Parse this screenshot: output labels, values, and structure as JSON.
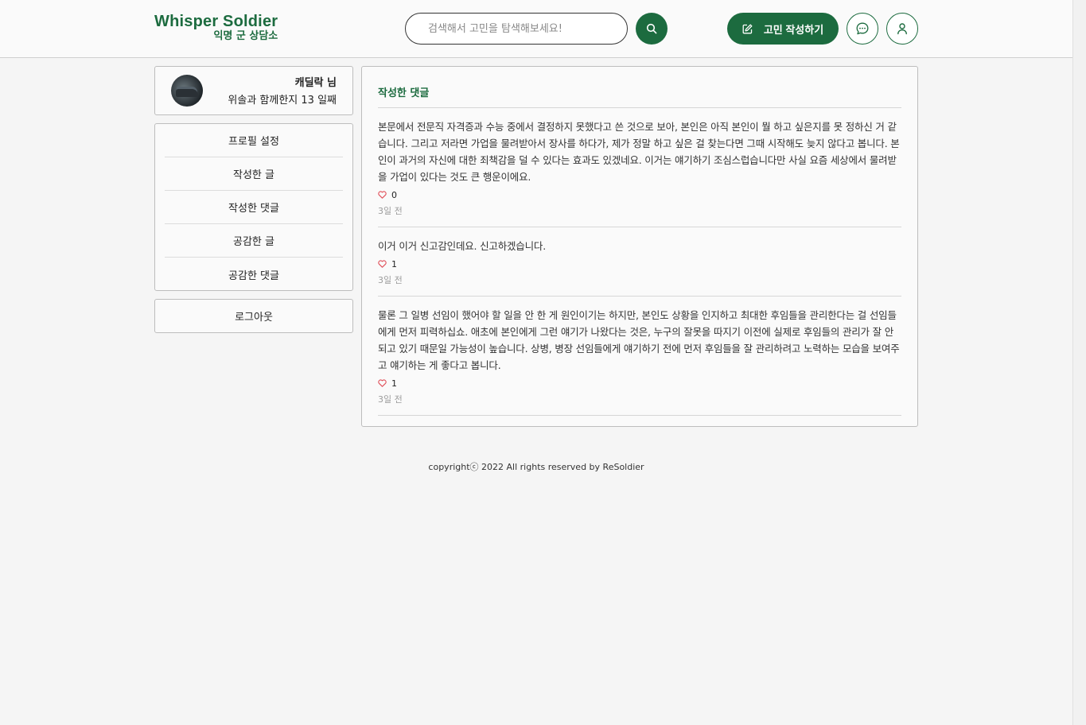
{
  "header": {
    "logo_title": "Whisper Soldier",
    "logo_subtitle": "익명 군 상담소",
    "search_placeholder": "검색해서 고민을 탐색해보세요!",
    "write_button": "고민 작성하기"
  },
  "profile": {
    "name": "캐딜락 님",
    "days_text": "위솔과 함께한지 13 일째"
  },
  "menu": {
    "items": [
      {
        "label": "프로필 설정"
      },
      {
        "label": "작성한 글"
      },
      {
        "label": "작성한 댓글"
      },
      {
        "label": "공감한 글"
      },
      {
        "label": "공감한 댓글"
      }
    ],
    "logout": "로그아웃"
  },
  "main": {
    "section_title": "작성한 댓글",
    "comments": [
      {
        "text": "본문에서 전문직 자격증과 수능 중에서 결정하지 못했다고 쓴 것으로 보아, 본인은 아직 본인이 뭘 하고 싶은지를 못 정하신 거 같습니다. 그리고 저라면 가업을 물려받아서 장사를 하다가, 제가 정말 하고 싶은 걸 찾는다면 그때 시작해도 늦지 않다고 봅니다. 본인이 과거의 자신에 대한 죄책감을 덜 수 있다는 효과도 있겠네요. 이거는 얘기하기 조심스럽습니다만 사실 요즘 세상에서 물려받을 가업이 있다는 것도 큰 행운이에요.",
        "likes": "0",
        "time": "3일 전"
      },
      {
        "text": "이거 이거 신고감인데요. 신고하겠습니다.",
        "likes": "1",
        "time": "3일 전"
      },
      {
        "text": "물론 그 일병 선임이 했어야 할 일을 안 한 게 원인이기는 하지만, 본인도 상황을 인지하고 최대한 후임들을 관리한다는 걸 선임들에게 먼저 피력하십쇼. 애초에 본인에게 그런 얘기가 나왔다는 것은, 누구의 잘못을 따지기 이전에 실제로 후임들의 관리가 잘 안 되고 있기 때문일 가능성이 높습니다. 상병, 병장 선임들에게 얘기하기 전에 먼저 후임들을 잘 관리하려고 노력하는 모습을 보여주고 얘기하는 게 좋다고 봅니다.",
        "likes": "1",
        "time": "3일 전"
      }
    ]
  },
  "footer": {
    "copyright": "copyrightⓒ 2022 All rights reserved by ReSoldier"
  },
  "colors": {
    "brand_green": "#1c6b3f",
    "like_heart": "#e0505a"
  }
}
